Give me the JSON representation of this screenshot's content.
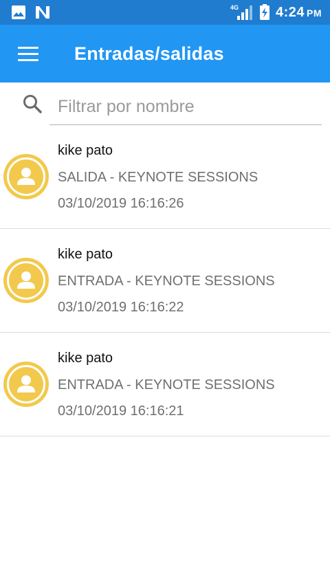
{
  "status_bar": {
    "time": "4:24",
    "ampm": "PM",
    "network": "4G",
    "icons": [
      "image-icon",
      "n-notification-icon",
      "signal-icon",
      "battery-charging-icon"
    ]
  },
  "app_bar": {
    "title": "Entradas/salidas",
    "menu_icon": "hamburger-menu-icon",
    "color": "#2196f3",
    "status_color": "#1f7ccf"
  },
  "search": {
    "placeholder": "Filtrar por nombre",
    "value": "",
    "icon": "search-icon"
  },
  "entries": [
    {
      "name": "kike pato",
      "description": "SALIDA - KEYNOTE SESSIONS",
      "timestamp": "03/10/2019 16:16:26"
    },
    {
      "name": "kike pato",
      "description": "ENTRADA - KEYNOTE SESSIONS",
      "timestamp": "03/10/2019 16:16:22"
    },
    {
      "name": "kike pato",
      "description": "ENTRADA - KEYNOTE SESSIONS",
      "timestamp": "03/10/2019 16:16:21"
    }
  ],
  "avatar_color": "#f2c94c"
}
